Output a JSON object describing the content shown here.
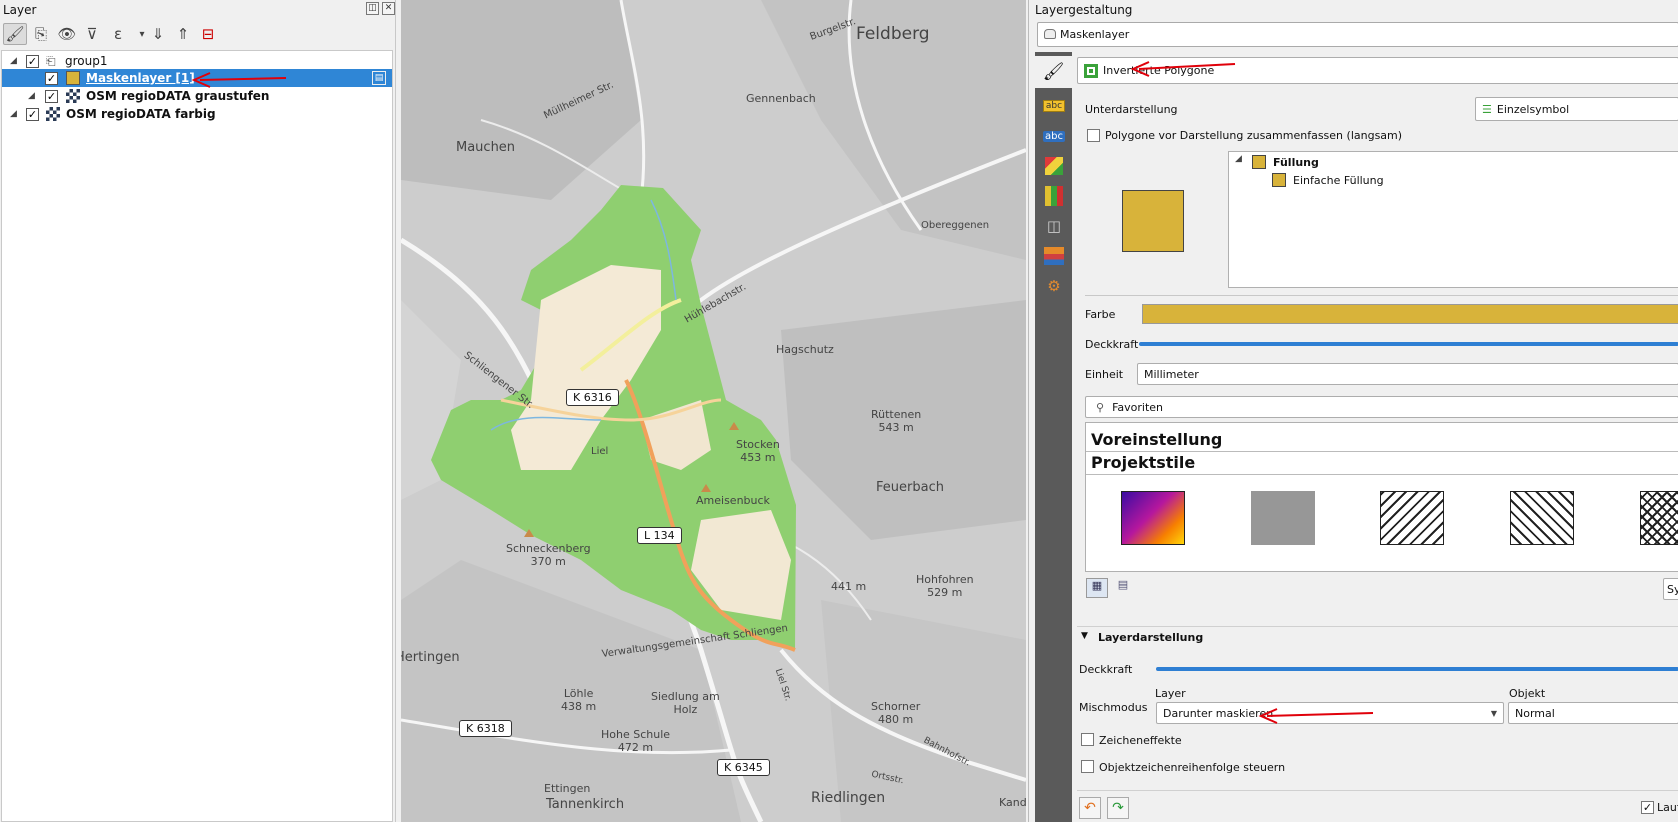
{
  "layer_panel": {
    "title": "Layer",
    "tree": [
      {
        "label": "group1",
        "checked": true,
        "kind": "group"
      },
      {
        "label": "Maskenlayer [1]",
        "checked": true,
        "kind": "vector",
        "selected": true
      },
      {
        "label": "OSM regioDATA graustufen",
        "checked": true,
        "kind": "raster"
      },
      {
        "label": "OSM regioDATA farbig",
        "checked": true,
        "kind": "raster"
      }
    ],
    "check_mark": "✓"
  },
  "map": {
    "places": [
      "Feldberg",
      "Burgelstr.",
      "Gennenbach",
      "Mauchen",
      "Müllheimer Str.",
      "Hagschutz",
      "Obereggenen",
      "Hühlebachstr.",
      "Schliengener Str.",
      "Rüttenen\n543 m",
      "Stocken\n453 m",
      "Liel",
      "Ameisenbuck",
      "Feuerbach",
      "Schneckenberg\n370 m",
      "441 m",
      "Hohfohren\n529 m",
      "Hertingen",
      "Verwaltungsgemeinschaft Schliengen",
      "Löhle\n438 m",
      "Siedlung am\nHolz",
      "Schorner\n480 m",
      "Hohe Schule\n472 m",
      "Liel Str.",
      "Bahnhofstr.",
      "Ortsstr.",
      "Riedlingen",
      "Ettingen",
      "Tannenkirch",
      "Kand"
    ],
    "road_labels": [
      "K 6316",
      "L 134",
      "K 6318",
      "K 6345"
    ]
  },
  "right_panel": {
    "title": "Layergestaltung",
    "layer_combo": "Maskenlayer",
    "renderer": "Invertierte Polygone",
    "sub_render_label": "Unterdarstellung",
    "sub_render_value": "Einzelsymbol",
    "merge_checkbox": "Polygone vor Darstellung zusammenfassen (langsam)",
    "symbol_tree": {
      "root": "Füllung",
      "child": "Einfache Füllung"
    },
    "color_label": "Farbe",
    "color_value": "#d8b33a",
    "opacity_label": "Deckkraft",
    "unit_label": "Einheit",
    "unit_value": "Millimeter",
    "search_placeholder": "Favoriten",
    "group_default": "Voreinstellung",
    "group_project": "Projektstile",
    "save_button": "Sym",
    "layer_rendering": "Layerdarstellung",
    "lr_opacity": "Deckkraft",
    "blend_label": "Mischmodus",
    "blend_layer_col": "Layer",
    "blend_object_col": "Objekt",
    "blend_layer_value": "Darunter maskieren",
    "blend_object_value": "Normal",
    "effects_label": "Zeicheneffekte",
    "order_label": "Objektzeichenreihenfolge steuern",
    "live_label": "Lauf"
  },
  "colors": {
    "accent": "#2f86d6",
    "fill": "#d8b33a",
    "arrow": "#e0000a",
    "map_green": "#8fcf70"
  }
}
